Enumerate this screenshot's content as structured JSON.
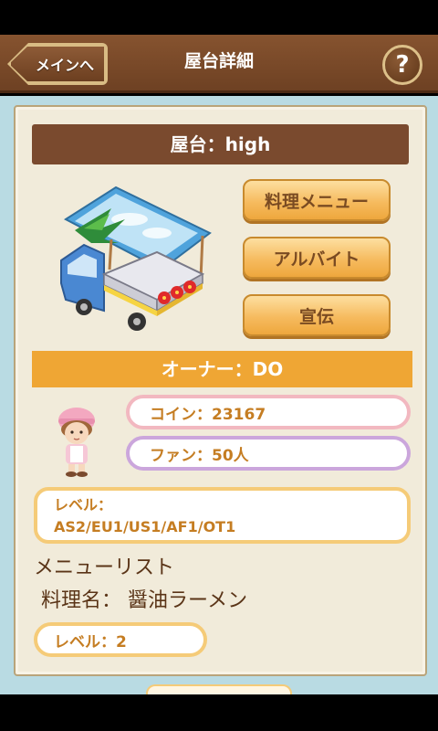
{
  "header": {
    "back_label": "メインへ",
    "title": "屋台詳細",
    "help_label": "?"
  },
  "stall": {
    "title": "屋台：high",
    "image_icon": "food-truck-icon"
  },
  "actions": {
    "menu_label": "料理メニュー",
    "parttime_label": "アルバイト",
    "promo_label": "宣伝"
  },
  "owner": {
    "label": "オーナー：DO",
    "avatar_icon": "chef-avatar-icon",
    "coin_text": "コイン：23167",
    "fan_text": "ファン：50人",
    "level_label": "レベル：",
    "level_value": "AS2/EU1/US1/AF1/OT1"
  },
  "menu_list": {
    "heading": "メニューリスト",
    "dish_name": "料理名： 醤油ラーメン",
    "dish_level": "レベル：2"
  },
  "colors": {
    "header_brown": "#7a4a2e",
    "owner_orange": "#efa634",
    "panel_cream": "#f1ebda",
    "content_blue": "#b9dbe3",
    "text_gold": "#c57d22"
  }
}
